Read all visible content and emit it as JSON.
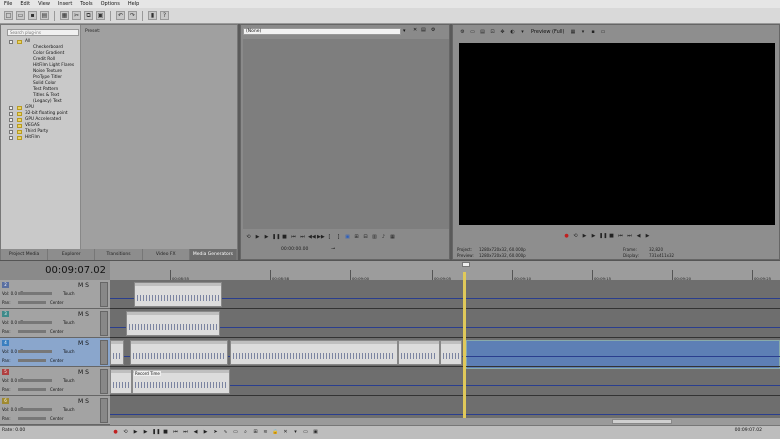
{
  "menu": [
    "File",
    "Edit",
    "View",
    "Insert",
    "Tools",
    "Options",
    "Help"
  ],
  "explorer": {
    "search_placeholder": "Search plug-ins",
    "preset_label": "Preset:",
    "tree": [
      {
        "label": "All",
        "level": 0,
        "folder": true
      },
      {
        "label": "Checkerboard",
        "level": 1
      },
      {
        "label": "Color Gradient",
        "level": 1
      },
      {
        "label": "Credit Roll",
        "level": 1
      },
      {
        "label": "HitFilm Light Flares",
        "level": 1
      },
      {
        "label": "Noise Texture",
        "level": 1
      },
      {
        "label": "ProType Titler",
        "level": 1
      },
      {
        "label": "Solid Color",
        "level": 1
      },
      {
        "label": "Test Pattern",
        "level": 1
      },
      {
        "label": "Titles & Text",
        "level": 1
      },
      {
        "label": "(Legacy) Text",
        "level": 1
      },
      {
        "label": "GPU",
        "level": 0,
        "folder": true
      },
      {
        "label": "32-bit floating point",
        "level": 0,
        "folder": true
      },
      {
        "label": "GPU Accelerated",
        "level": 0,
        "folder": true
      },
      {
        "label": "VEGAS",
        "level": 0,
        "folder": true
      },
      {
        "label": "Third Party",
        "level": 0,
        "folder": true
      },
      {
        "label": "HitFilm",
        "level": 0,
        "folder": true
      }
    ],
    "tabs": [
      "Project Media",
      "Explorer",
      "Transitions",
      "Video FX",
      "Media Generators"
    ],
    "active_tab": "Media Generators"
  },
  "trimmer": {
    "select_value": "(None)",
    "timecode": "00:00:00.00"
  },
  "preview": {
    "quality_label": "Preview (Full)",
    "project_label": "Project:",
    "project_value": "1280x720x32, 60.000p",
    "preview_label": "Preview:",
    "preview_value": "1280x720x32, 60.000p",
    "frame_label": "Frame:",
    "frame_value": "32,820",
    "display_label": "Display:",
    "display_value": "731x411x32"
  },
  "timeline": {
    "timecode": "00:09:07.02",
    "ruler_labels": [
      "00:08:55",
      "00:08:58",
      "00:09:00",
      "00:09:05",
      "00:09:10",
      "00:09:15",
      "00:09:20",
      "00:09:25"
    ],
    "tracks": [
      {
        "num": "2",
        "vol": "Vol:",
        "vol_val": "0.0 dB",
        "pan": "Pan:",
        "pan_val": "Center",
        "mode": "Touch",
        "color": "#5a6fa0"
      },
      {
        "num": "3",
        "vol": "Vol:",
        "vol_val": "0.0 dB",
        "pan": "Pan:",
        "pan_val": "Center",
        "mode": "Touch",
        "color": "#3f8a8a"
      },
      {
        "num": "4",
        "vol": "Vol:",
        "vol_val": "0.0 dB",
        "pan": "Pan:",
        "pan_val": "Center",
        "mode": "Touch",
        "color": "#3a7fc0"
      },
      {
        "num": "5",
        "vol": "Vol:",
        "vol_val": "0.0 dB",
        "pan": "Pan:",
        "pan_val": "Center",
        "mode": "Touch",
        "color": "#b04040"
      },
      {
        "num": "6",
        "vol": "Vol:",
        "vol_val": "0.0 dB",
        "pan": "Pan:",
        "pan_val": "Center",
        "mode": "Touch",
        "color": "#a08a30"
      }
    ],
    "clip_label": "Record Time"
  },
  "bottom": {
    "rate": "Rate: 0.00",
    "timecode": "00:09:07.02"
  }
}
